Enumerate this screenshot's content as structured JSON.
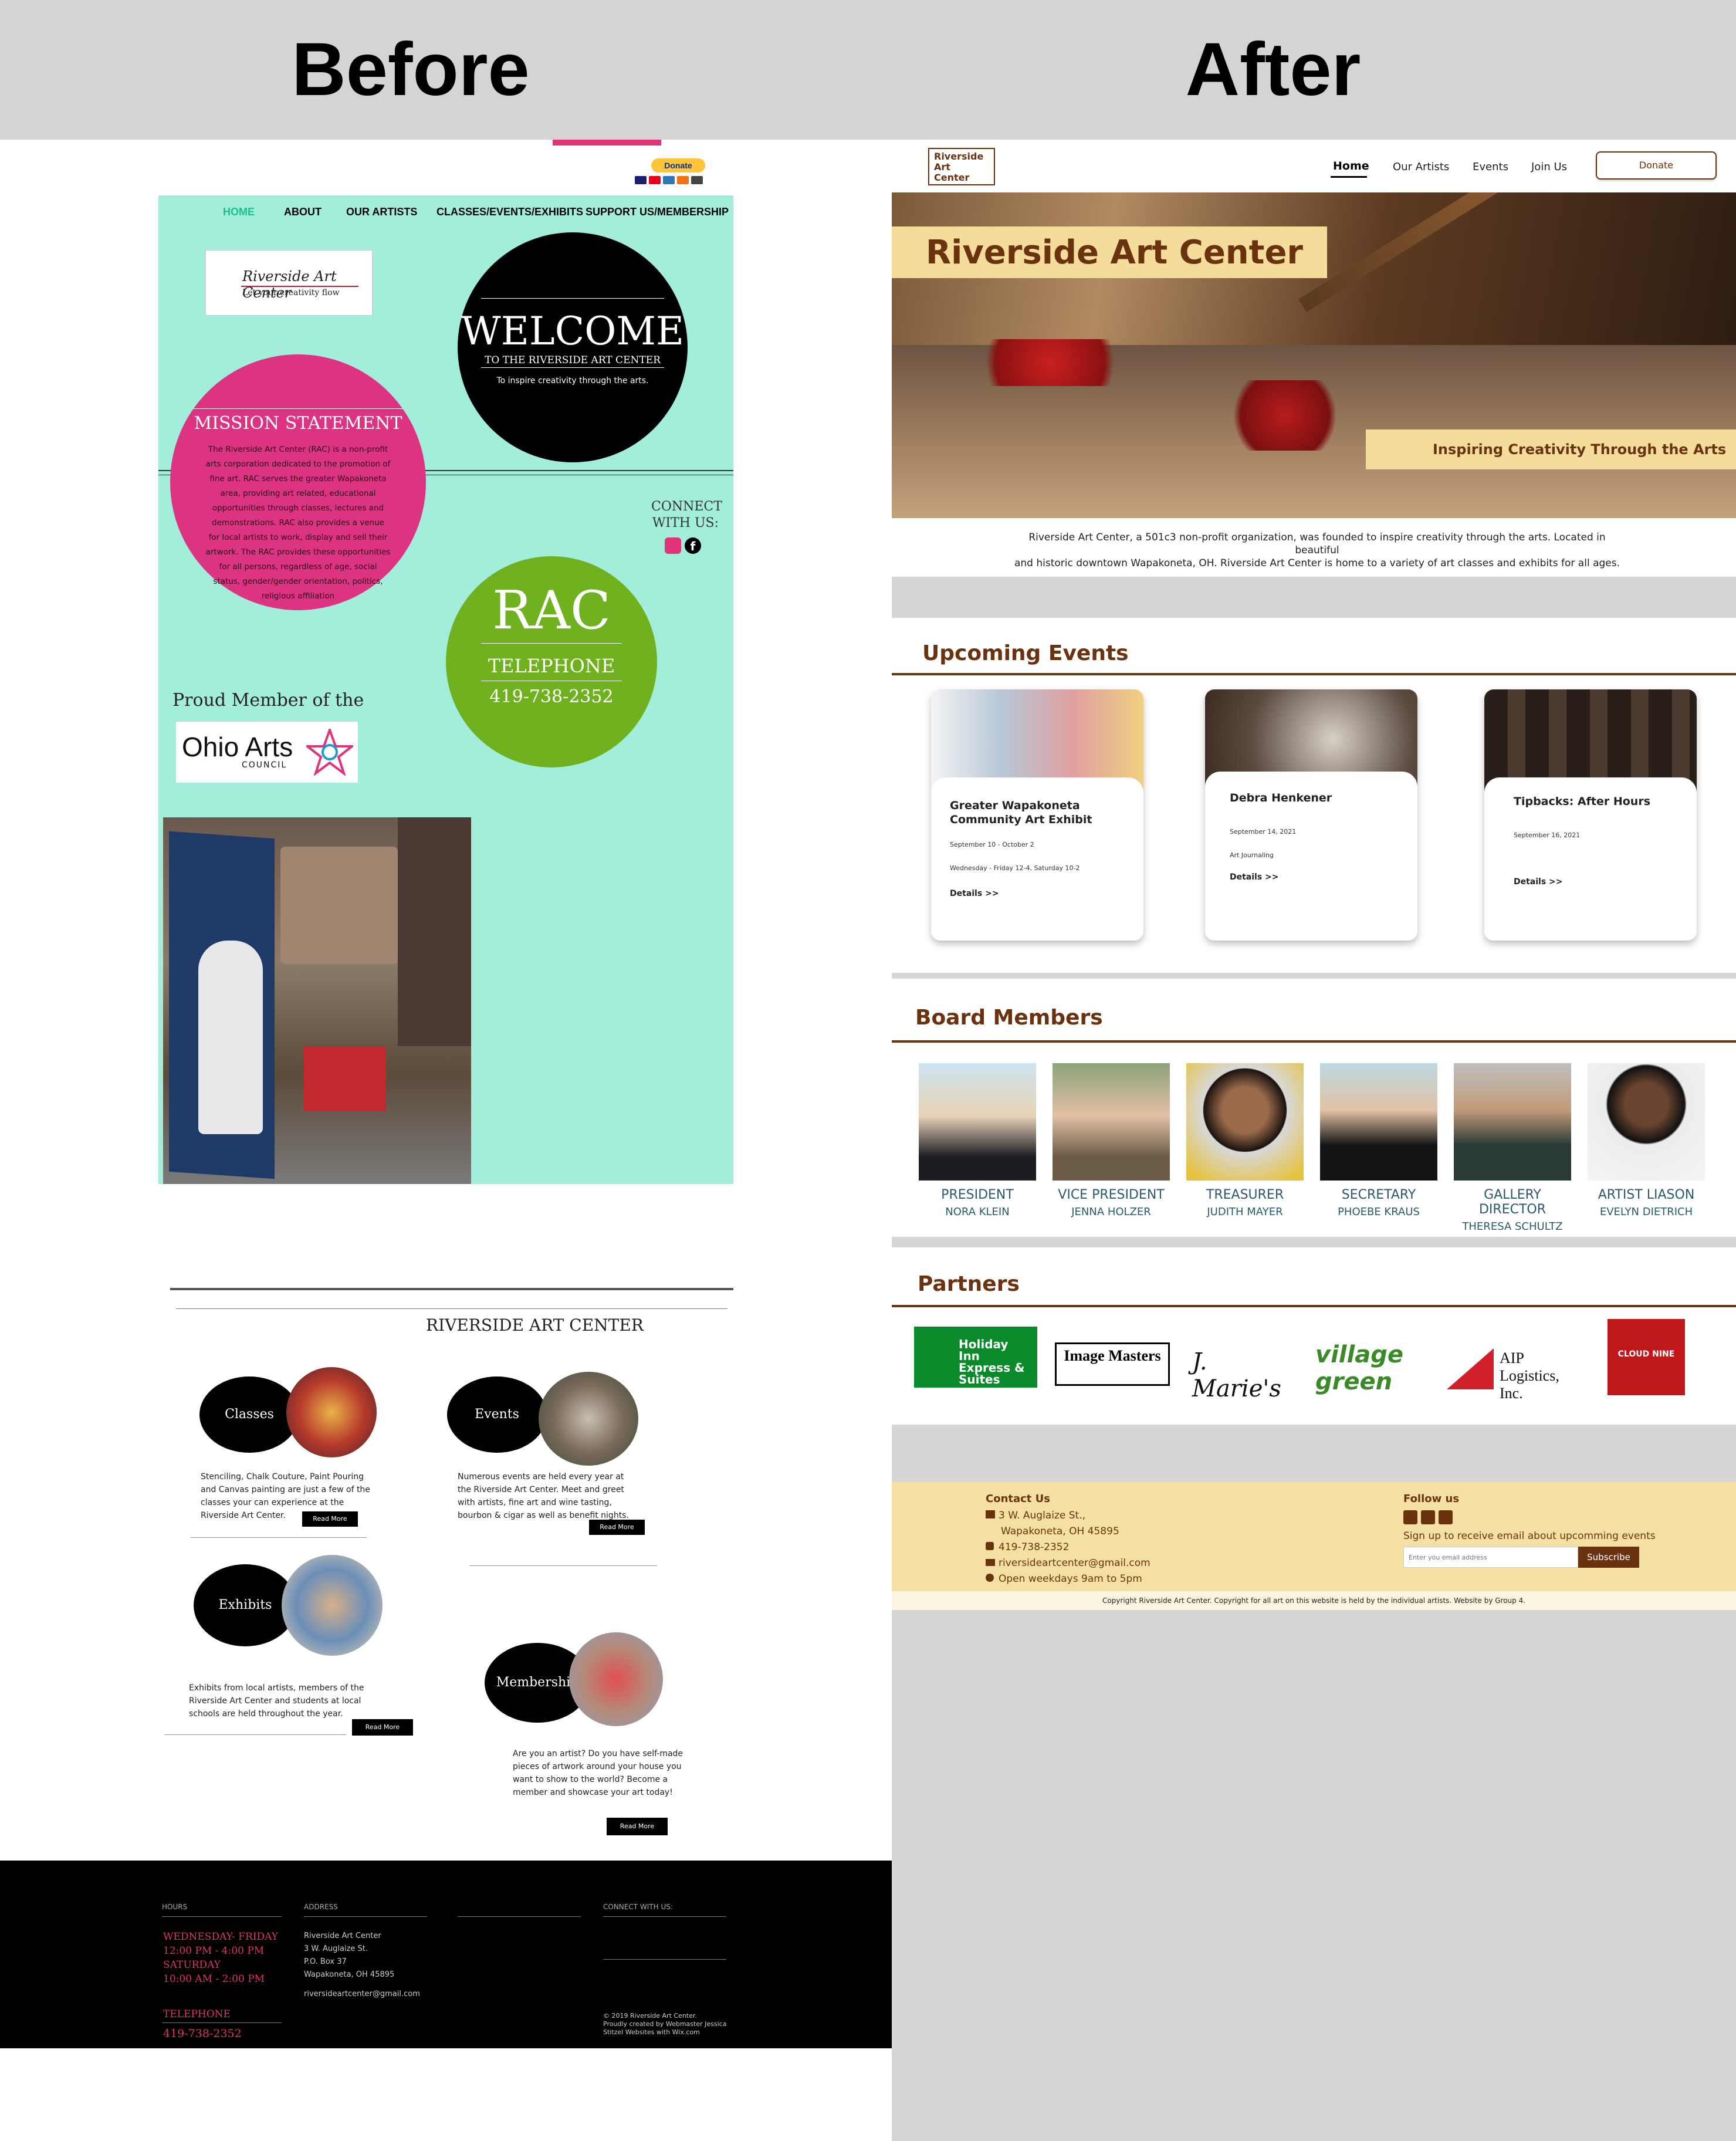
{
  "header": {
    "before": "Before",
    "after": "After"
  },
  "before": {
    "donate": "Donate",
    "nav": [
      "HOME",
      "ABOUT",
      "OUR ARTISTS",
      "CLASSES/EVENTS/EXHIBITS",
      "SUPPORT US/MEMBERSHIP"
    ],
    "logo": {
      "name": "Riverside Art Center",
      "tagline": "Let your creativity flow"
    },
    "welcome": {
      "title": "WELCOME",
      "sub": "TO THE RIVERSIDE ART CENTER",
      "line": "To inspire creativity through the arts."
    },
    "mission": {
      "title": "MISSION STATEMENT",
      "text": "The Riverside Art Center (RAC) is a non-profit arts corporation dedicated to the promotion of fine art. RAC serves the greater Wapakoneta area, providing art related, educational opportunities through classes, lectures and demonstrations. RAC also provides a venue for local artists to work, display and sell their artwork. The RAC provides these opportunities for all persons, regardless of age, social status, gender/gender orientation, politics, religious affiliation"
    },
    "connect": "CONNECT WITH US:",
    "rac": {
      "title": "RAC",
      "label": "TELEPHONE",
      "phone": "419-738-2352"
    },
    "proud": "Proud Member of the",
    "ohio": {
      "name": "Ohio Arts",
      "sub": "COUNCIL"
    },
    "section_title": "RIVERSIDE ART CENTER",
    "classes": {
      "label": "Classes",
      "text": "Stenciling, Chalk Couture, Paint Pouring and Canvas painting are just a few of the classes your can experience at the Riverside Art Center."
    },
    "events": {
      "label": "Events",
      "text": "Numerous events are held every year at the Riverside Art Center. Meet and greet with artists, fine art and wine tasting, bourbon & cigar  as well as benefit nights."
    },
    "exhibits": {
      "label": "Exhibits",
      "text": "Exhibits from local artists, members of the Riverside Art Center and students at local schools are held throughout the year."
    },
    "membership": {
      "label": "Membership",
      "text": "Are you an artist? Do you have self-made pieces of artwork around your house you want to show to the world? Become a member and showcase your art today!"
    },
    "read_more": "Read More",
    "footer": {
      "hours_label": "HOURS",
      "hours": [
        "WEDNESDAY- FRIDAY",
        "12:00 PM - 4:00 PM",
        "SATURDAY",
        "10:00 AM - 2:00 PM"
      ],
      "tel_label": "TELEPHONE",
      "tel": "419-738-2352",
      "address_label": "ADDRESS",
      "address": [
        "Riverside Art Center",
        "3 W. Auglaize St.",
        "P.O. Box 37",
        "Wapakoneta, OH 45895"
      ],
      "email": "riversideartcenter@gmail.com",
      "connect_label": "CONNECT WITH US:",
      "copyright": [
        "© 2019 Riverside  Art Center.",
        "Proudly created by Webmaster Jessica",
        "Stitzel Websites with Wix.com"
      ]
    }
  },
  "after": {
    "logo": [
      "Riverside",
      "Art",
      "Center"
    ],
    "nav": [
      "Home",
      "Our Artists",
      "Events",
      "Join Us"
    ],
    "donate": "Donate",
    "hero_title": "Riverside Art Center",
    "hero_tag": "Inspiring Creativity Through the Arts",
    "intro": [
      "Riverside Art Center, a 501c3 non-profit organization, was founded to inspire creativity through the arts. Located in beautiful",
      "and historic downtown Wapakoneta, OH. Riverside Art Center is home to a variety of art classes and exhibits for all ages."
    ],
    "events_title": "Upcoming Events",
    "events": [
      {
        "title": [
          "Greater Wapakoneta",
          "Community Art Exhibit"
        ],
        "lines": [
          "September 10 - October 2",
          "Wednesday - Friday 12-4, Saturday 10-2"
        ],
        "details": "Details >>"
      },
      {
        "title": [
          "Debra Henkener"
        ],
        "lines": [
          "September 14, 2021",
          "Art Journaling"
        ],
        "details": "Details >>"
      },
      {
        "title": [
          "Tipbacks: After Hours"
        ],
        "lines": [
          "September 16, 2021"
        ],
        "details": "Details >>"
      }
    ],
    "board_title": "Board Members",
    "board": [
      {
        "role": "PRESIDENT",
        "name": "NORA KLEIN"
      },
      {
        "role": "VICE PRESIDENT",
        "name": "JENNA HOLZER"
      },
      {
        "role": "TREASURER",
        "name": "JUDITH MAYER"
      },
      {
        "role": "SECRETARY",
        "name": "PHOEBE KRAUS"
      },
      {
        "role": "GALLERY DIRECTOR",
        "name": "THERESA SCHULTZ"
      },
      {
        "role": "ARTIST LIASON",
        "name": "EVELYN DIETRICH"
      }
    ],
    "partners_title": "Partners",
    "partners": [
      "Holiday Inn Express & Suites",
      "Image Masters",
      "J. Marie's",
      "village green",
      "AIP Logistics, Inc.",
      "CLOUD NINE"
    ],
    "footer": {
      "contact_title": "Contact Us",
      "address1": "3 W. Auglaize St.,",
      "address2": "Wapakoneta, OH 45895",
      "phone": "419-738-2352",
      "email": "riversideartcenter@gmail.com",
      "hours": "Open weekdays 9am to 5pm",
      "follow_title": "Follow us",
      "signup": "Sign up to receive email about upcomming events",
      "email_placeholder": "Enter you email address",
      "subscribe": "Subscribe",
      "copyright": "Copyright Riverside Art Center. Copyright for all art on this website is held by the individual artists. Website by Group 4."
    }
  }
}
